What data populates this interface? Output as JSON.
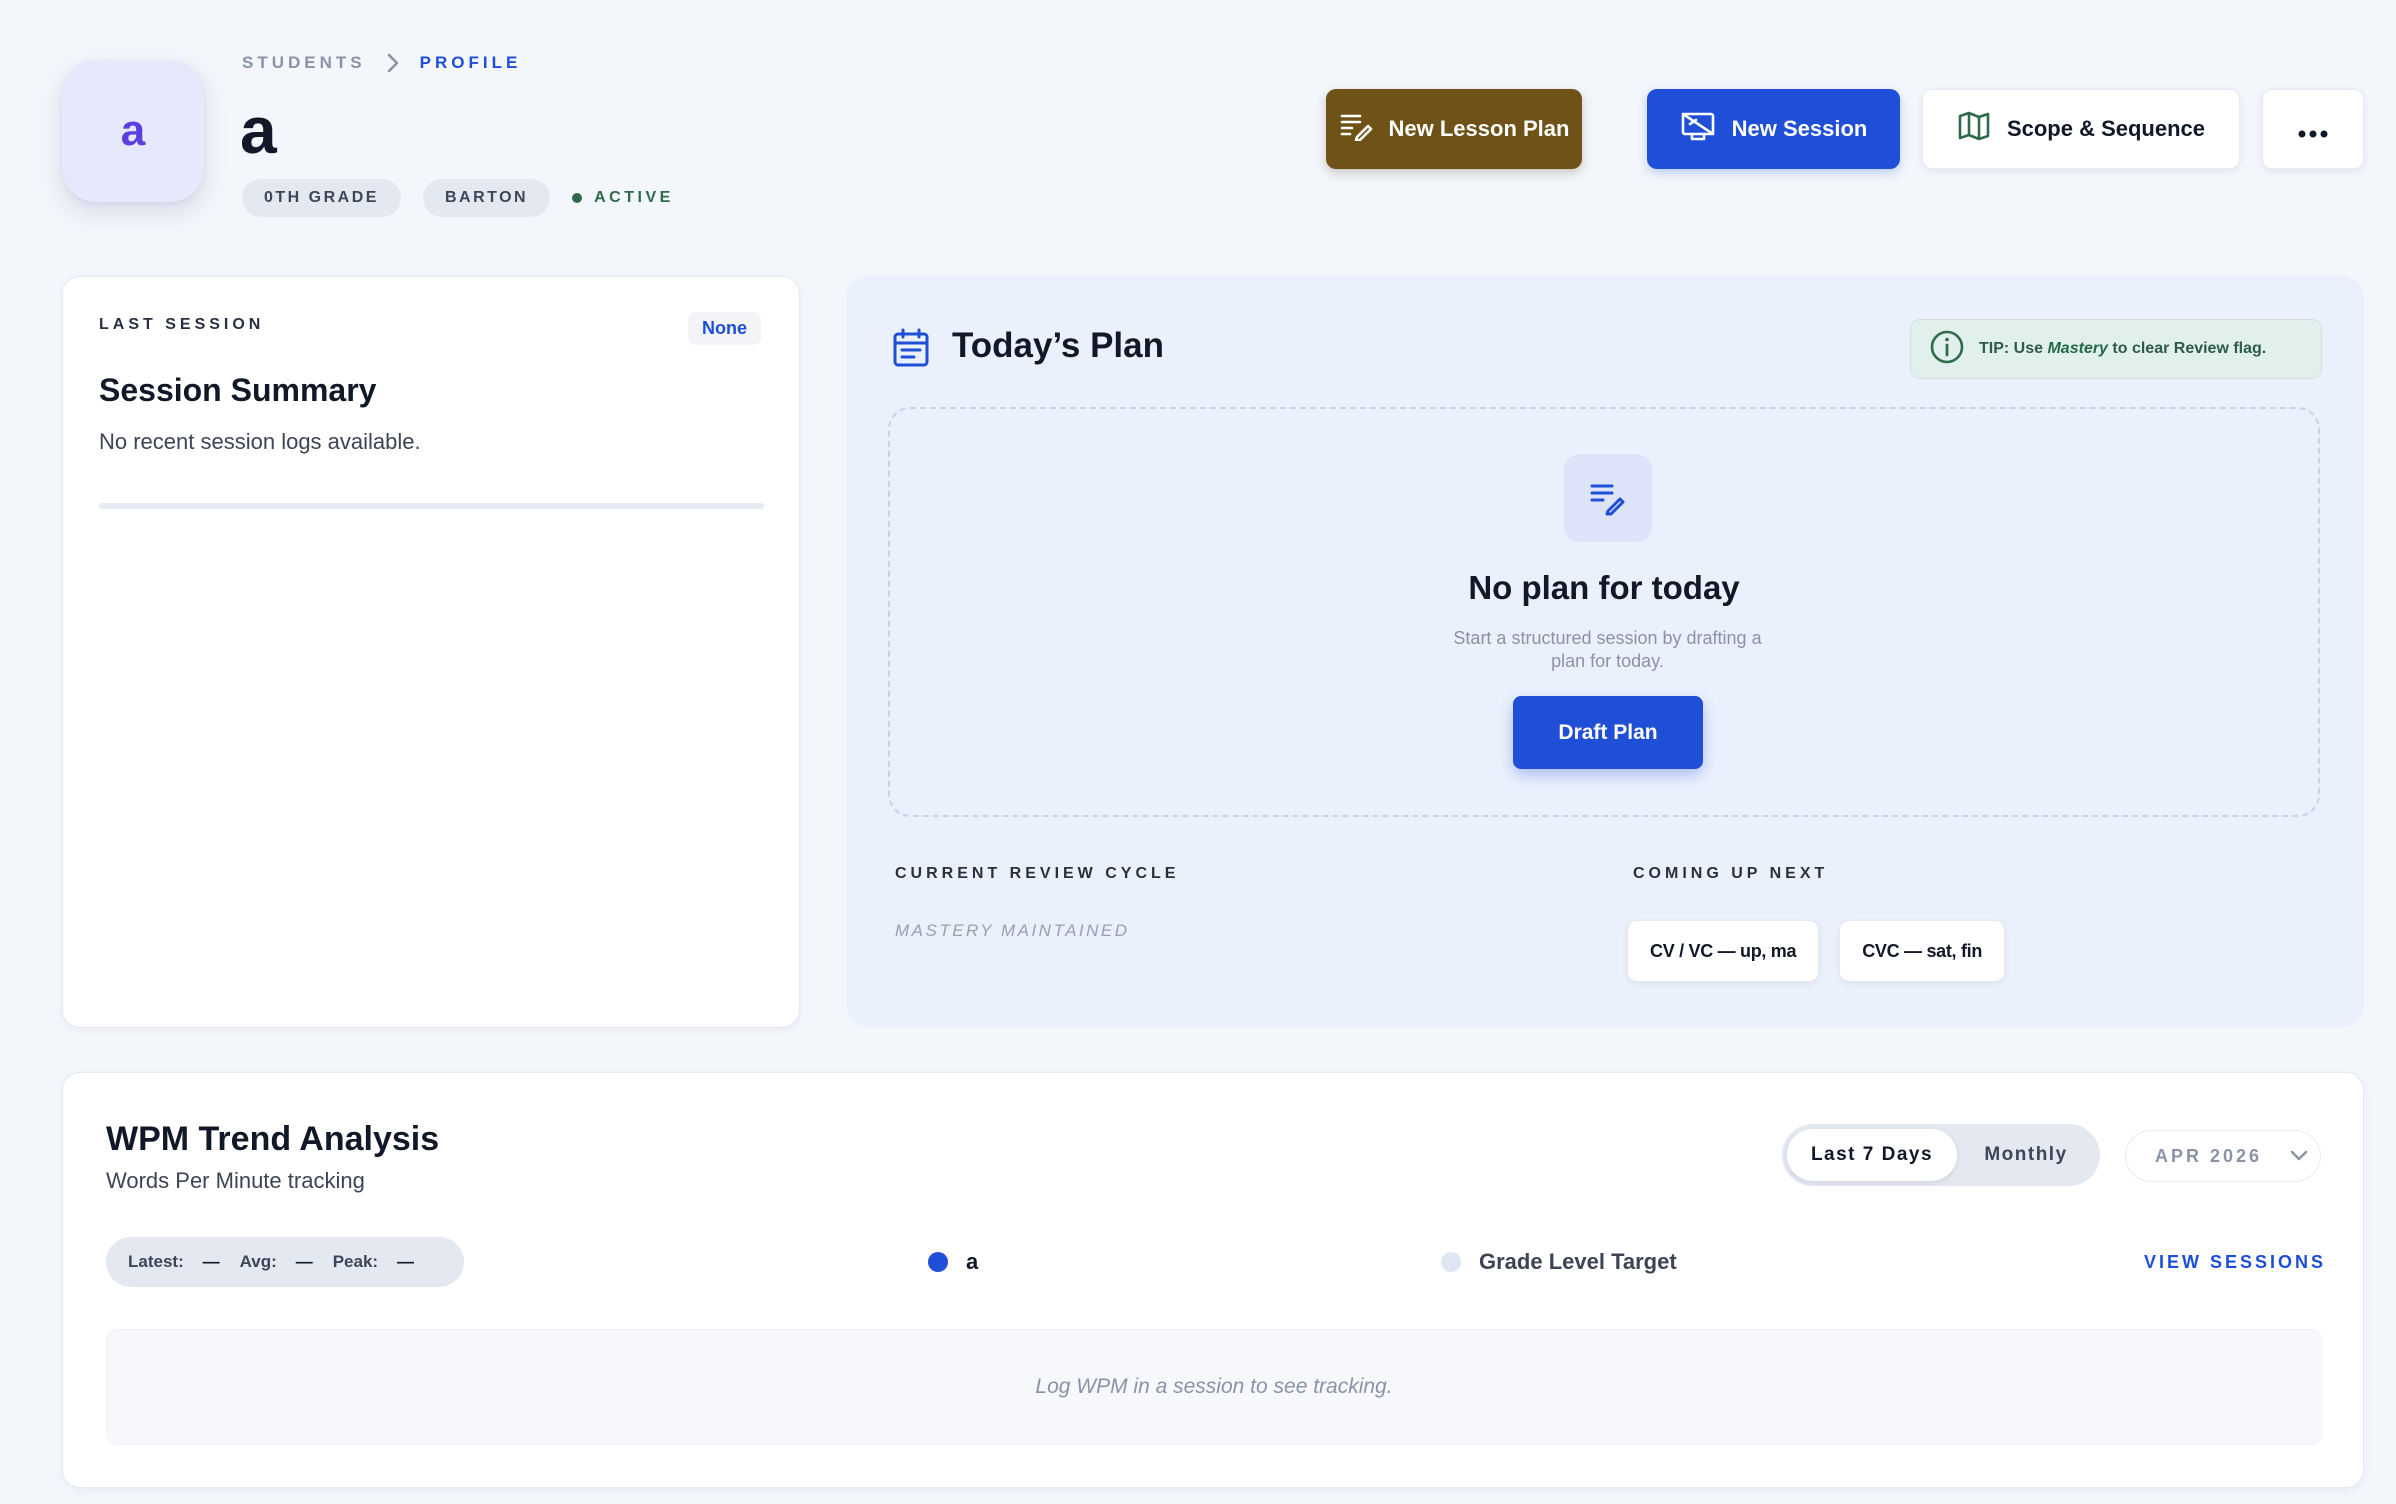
{
  "header": {
    "avatar_initial": "a",
    "breadcrumb": [
      "STUDENTS",
      "PROFILE"
    ],
    "student_name": "a",
    "chips": [
      "0TH GRADE",
      "BARTON"
    ],
    "status": "ACTIVE",
    "actions": {
      "new_lesson_plan": "New Lesson Plan",
      "new_session": "New Session",
      "scope_sequence": "Scope & Sequence",
      "more": "•••"
    }
  },
  "last_session": {
    "overline": "LAST SESSION",
    "badge": "None",
    "title": "Session Summary",
    "message": "No recent session logs available."
  },
  "todays_plan": {
    "title": "Today’s Plan",
    "tip_prefix": "TIP: Use ",
    "tip_emphasis": "Mastery",
    "tip_suffix": " to clear Review flag.",
    "empty_title": "No plan for today",
    "empty_subtitle": "Start a structured session by drafting a plan for today.",
    "draft_button": "Draft Plan",
    "review_cycle_label": "CURRENT REVIEW CYCLE",
    "review_cycle_status": "MASTERY MAINTAINED",
    "coming_up_label": "COMING UP NEXT",
    "coming_up": [
      "CV / VC — up, ma",
      "CVC — sat, fin"
    ]
  },
  "wpm": {
    "title": "WPM Trend Analysis",
    "subtitle": "Words Per Minute tracking",
    "range_options": [
      "Last 7 Days",
      "Monthly"
    ],
    "selected_range": "Last 7 Days",
    "month": "APR 2026",
    "stats": {
      "latest_label": "Latest:",
      "latest_value": "—",
      "avg_label": "Avg:",
      "avg_value": "—",
      "peak_label": "Peak:",
      "peak_value": "—"
    },
    "legend": [
      {
        "label": "a",
        "color": "#1f4fd6"
      },
      {
        "label": "Grade Level Target",
        "color": "#dfe6f3"
      }
    ],
    "view_sessions": "VIEW SESSIONS",
    "empty_message": "Log WPM in a session to see tracking."
  },
  "colors": {
    "primary": "#1f4fd6",
    "lesson_button": "#6e5217",
    "active_status": "#2f6b4a"
  }
}
